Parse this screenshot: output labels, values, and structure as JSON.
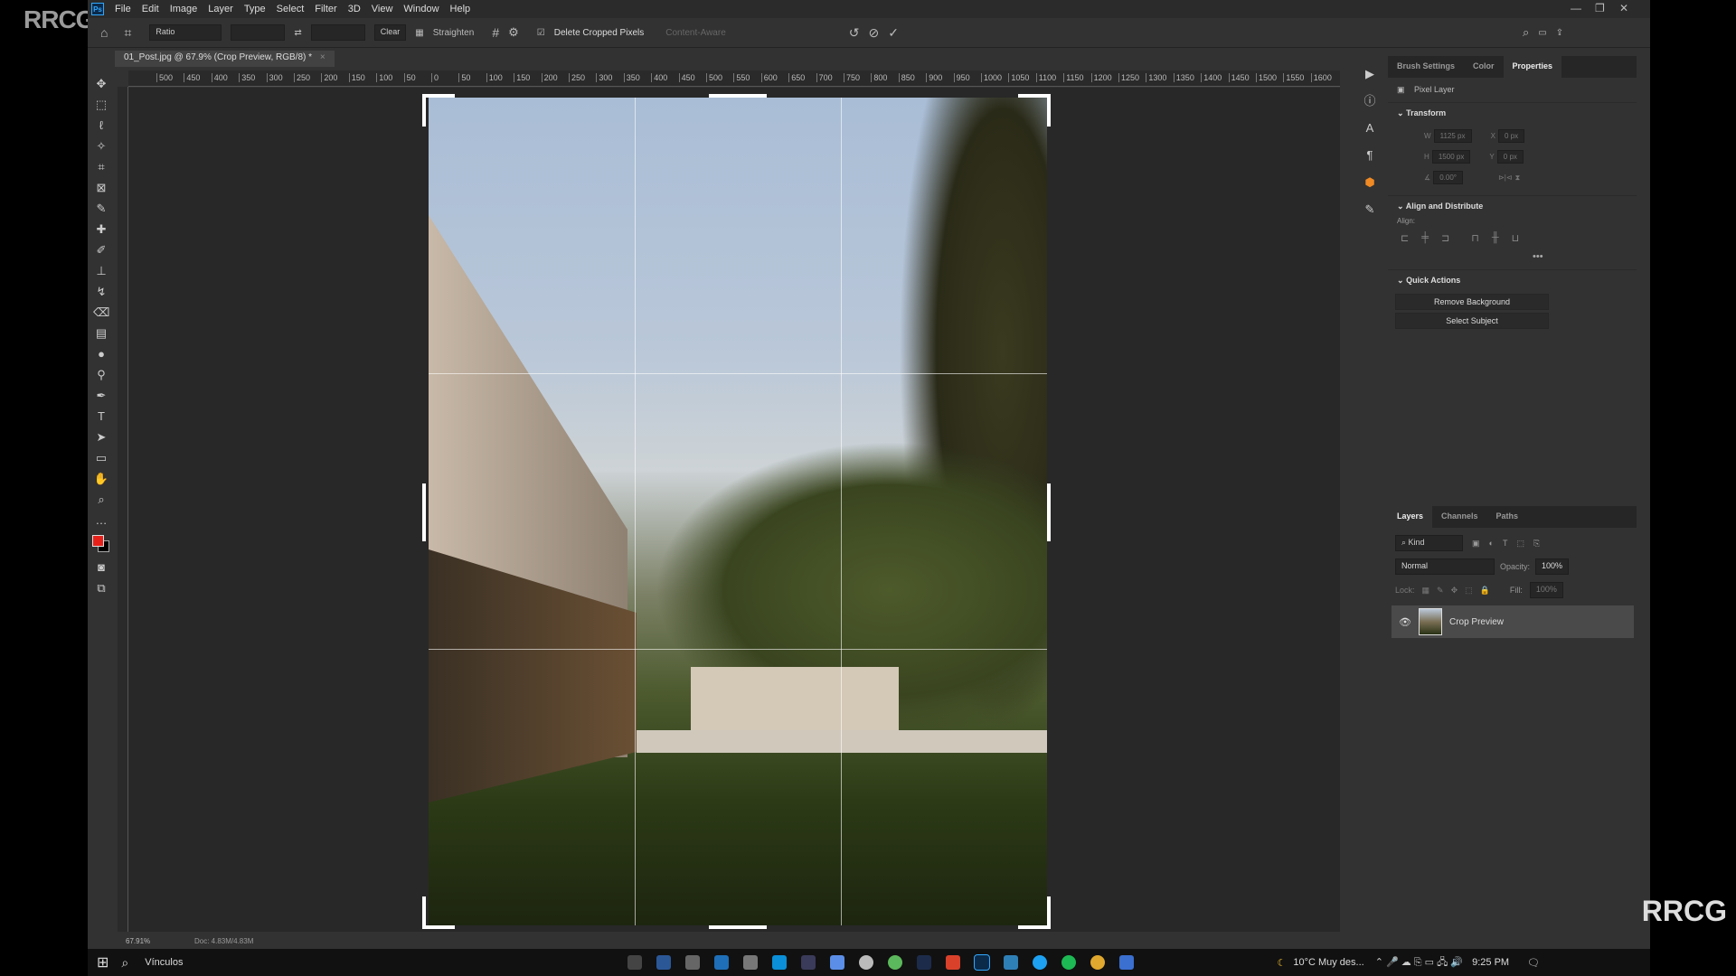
{
  "watermark": "RRCG",
  "app": {
    "icon": "Ps",
    "menu": [
      "File",
      "Edit",
      "Image",
      "Layer",
      "Type",
      "Select",
      "Filter",
      "3D",
      "View",
      "Window",
      "Help"
    ]
  },
  "options": {
    "ratio": "Ratio",
    "clear": "Clear",
    "straighten": "Straighten",
    "delete_cropped": "Delete Cropped Pixels",
    "delete_cropped_checked": true,
    "content_aware": "Content-Aware"
  },
  "document": {
    "tab": "01_Post.jpg @ 67.9% (Crop Preview, RGB/8) *",
    "close": "×"
  },
  "ruler": {
    "labels": [
      "500",
      "450",
      "400",
      "350",
      "300",
      "250",
      "200",
      "150",
      "100",
      "50",
      "0",
      "50",
      "100",
      "150",
      "200",
      "250",
      "300",
      "350",
      "400",
      "450",
      "500",
      "550",
      "600",
      "650",
      "700",
      "750",
      "800",
      "850",
      "900",
      "950",
      "1000",
      "1050",
      "1100",
      "1150",
      "1200",
      "1250",
      "1300",
      "1350",
      "1400",
      "1450",
      "1500",
      "1550",
      "1600"
    ]
  },
  "properties": {
    "tabs": [
      "Brush Settings",
      "Color",
      "Properties"
    ],
    "active_tab": "Properties",
    "layer_type": "Pixel Layer",
    "transform": {
      "title": "Transform",
      "w_label": "W",
      "w": "1125 px",
      "h_label": "H",
      "h": "1500 px",
      "x_label": "X",
      "x": "0 px",
      "y_label": "Y",
      "y": "0 px",
      "angle": "0.00°"
    },
    "align": {
      "title": "Align and Distribute",
      "label": "Align:",
      "more": "•••"
    },
    "quick": {
      "title": "Quick Actions",
      "remove_bg": "Remove Background",
      "select_subject": "Select Subject"
    }
  },
  "layers": {
    "tabs": [
      "Layers",
      "Channels",
      "Paths"
    ],
    "kind_placeholder": "Kind",
    "blend": "Normal",
    "opacity_label": "Opacity:",
    "opacity": "100%",
    "lock_label": "Lock:",
    "fill_label": "Fill:",
    "fill": "100%",
    "items": [
      {
        "name": "Crop Preview",
        "visible": true
      }
    ]
  },
  "status": {
    "zoom": "67.91%",
    "doc": "Doc: 4.83M/4.83M"
  },
  "taskbar": {
    "search_text": "Vínculos",
    "weather": "10°C  Muy des...",
    "time": "9:25 PM"
  },
  "colors": {
    "foreground": "#e8201a",
    "background": "#000000",
    "accent": "#31a8ff"
  }
}
